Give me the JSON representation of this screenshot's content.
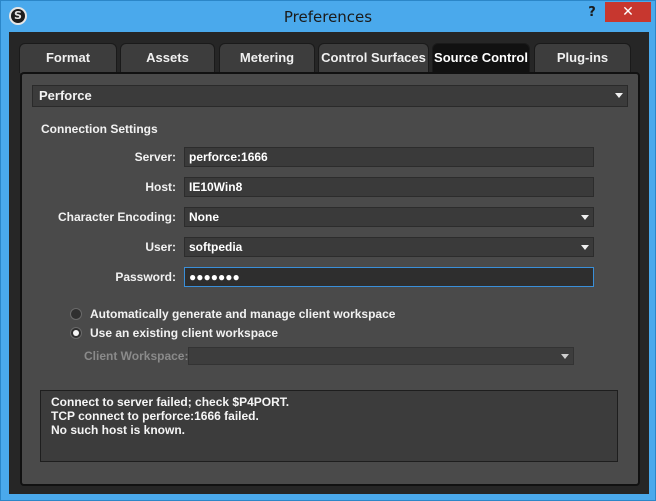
{
  "window": {
    "title": "Preferences",
    "help_glyph": "?",
    "close_glyph": "✕",
    "app_icon_glyph": "S"
  },
  "tabs": [
    {
      "label": "Format"
    },
    {
      "label": "Assets"
    },
    {
      "label": "Metering"
    },
    {
      "label": "Control Surfaces"
    },
    {
      "label": "Source Control"
    },
    {
      "label": "Plug-ins"
    }
  ],
  "active_tab": "Source Control",
  "source_control": {
    "provider": "Perforce",
    "connection_settings_title": "Connection Settings",
    "server_label": "Server:",
    "server_value": "perforce:1666",
    "host_label": "Host:",
    "host_value": "IE10Win8",
    "char_encoding_label": "Character Encoding:",
    "char_encoding_value": "None",
    "user_label": "User:",
    "user_value": "softpedia",
    "password_label": "Password:",
    "password_value": "●●●●●●●",
    "workspace_option_auto": "Automatically generate and manage client workspace",
    "workspace_option_existing": "Use an existing client workspace",
    "selected_workspace_option": "existing",
    "client_workspace_label": "Client Workspace:",
    "client_workspace_value": ""
  },
  "log": {
    "lines": [
      "Connect to server failed; check $P4PORT.",
      "TCP connect to perforce:1666 failed.",
      "No such host is known."
    ]
  },
  "colors": {
    "titlebar": "#4aa9ec",
    "close_button": "#c7372f",
    "panel": "#4a4a4a",
    "focus_border": "#3a8fd9"
  }
}
